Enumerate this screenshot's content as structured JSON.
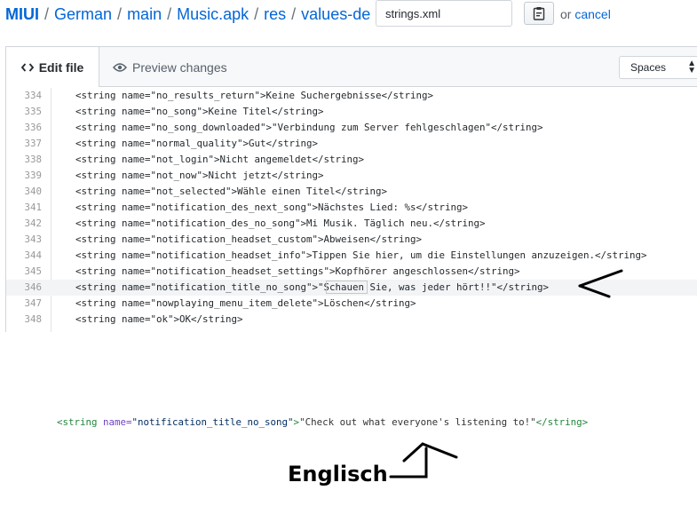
{
  "breadcrumb": {
    "root": "MIUI",
    "segments": [
      "German",
      "main",
      "Music.apk",
      "res",
      "values-de"
    ],
    "separator": "/"
  },
  "filename": {
    "value": "strings.xml"
  },
  "actions": {
    "or_text": "or",
    "cancel_label": "cancel"
  },
  "tabs": {
    "edit_label": "Edit file",
    "preview_label": "Preview changes"
  },
  "indent": {
    "selected": "Spaces"
  },
  "editor": {
    "lines": [
      {
        "num": "334",
        "text": "<string name=\"no_results_return\">Keine Suchergebnisse</string>"
      },
      {
        "num": "335",
        "text": "<string name=\"no_song\">Keine Titel</string>"
      },
      {
        "num": "336",
        "text": "<string name=\"no_song_downloaded\">\"Verbindung zum Server fehlgeschlagen\"</string>"
      },
      {
        "num": "337",
        "text": "<string name=\"normal_quality\">Gut</string>"
      },
      {
        "num": "338",
        "text": "<string name=\"not_login\">Nicht angemeldet</string>"
      },
      {
        "num": "339",
        "text": "<string name=\"not_now\">Nicht jetzt</string>"
      },
      {
        "num": "340",
        "text": "<string name=\"not_selected\">Wähle einen Titel</string>"
      },
      {
        "num": "341",
        "text": "<string name=\"notification_des_next_song\">Nächstes Lied: %s</string>"
      },
      {
        "num": "342",
        "text": "<string name=\"notification_des_no_song\">Mi Musik. Täglich neu.</string>"
      },
      {
        "num": "343",
        "text": "<string name=\"notification_headset_custom\">Abweisen</string>"
      },
      {
        "num": "344",
        "text": "<string name=\"notification_headset_info\">Tippen Sie hier, um die Einstellungen anzuzeigen.</string>"
      },
      {
        "num": "345",
        "text": "<string name=\"notification_headset_settings\">Kopfhörer angeschlossen</string>"
      },
      {
        "num": "346",
        "text": "<string name=\"notification_title_no_song\">\"Schauen Sie, was jeder hört!!\"</string>"
      },
      {
        "num": "347",
        "text": "<string name=\"nowplaying_menu_item_delete\">Löschen</string>"
      },
      {
        "num": "348",
        "text": "<string name=\"ok\">OK</string>"
      }
    ]
  },
  "annotation": {
    "english_open": "<string",
    "english_attr": " name=",
    "english_attr_value": "\"notification_title_no_song\"",
    "english_gt": ">",
    "english_content": "\"Check out what everyone's listening to!\"",
    "english_close": "</string>",
    "label": "Englisch"
  },
  "icons": {
    "edit": "code-icon",
    "preview": "eye-icon",
    "copy": "clipboard-icon"
  }
}
